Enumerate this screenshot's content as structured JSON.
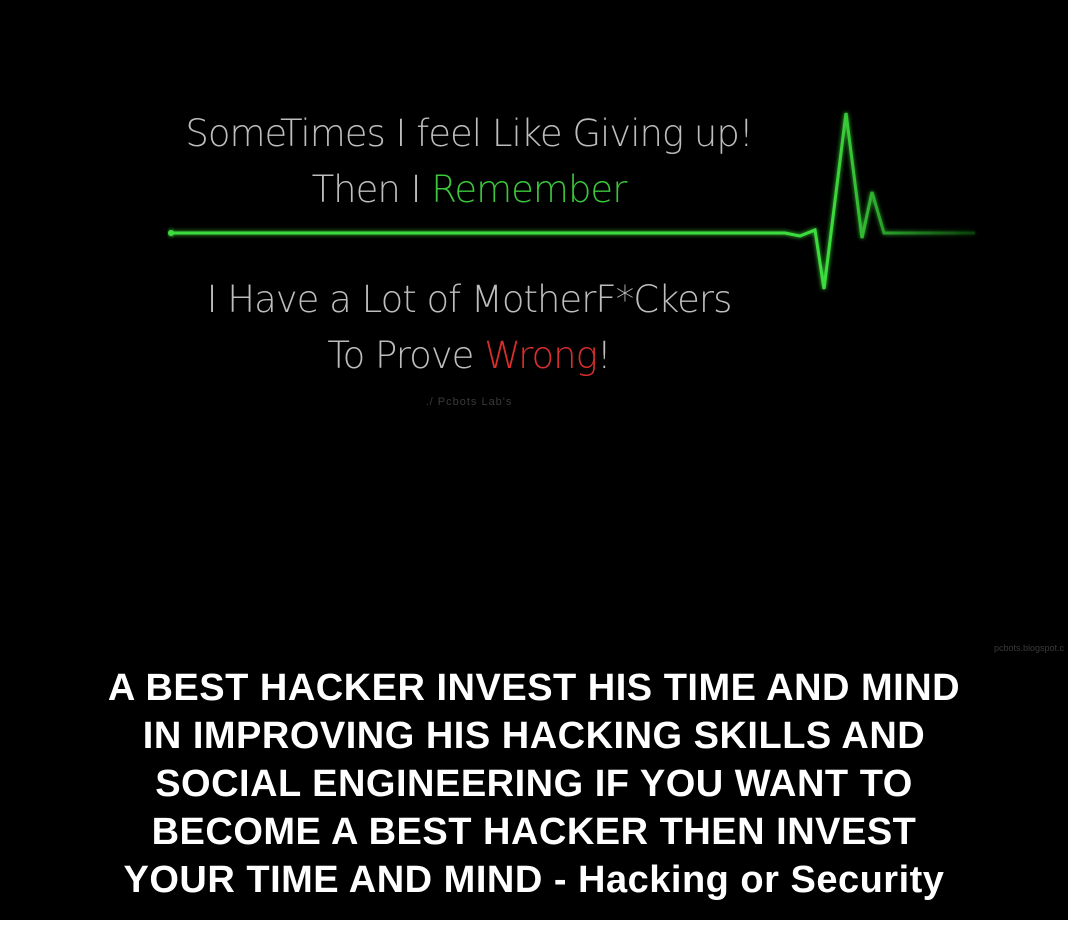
{
  "quote": {
    "line1": "SomeTimes I feel Like Giving up!",
    "line2_prefix": "Then I ",
    "line2_highlight": "Remember",
    "line3": "I Have a Lot of MotherF*Ckers",
    "line4_prefix": "To Prove ",
    "line4_highlight": "Wrong",
    "line4_suffix": "!",
    "signature": "./ Pcbots Lab's"
  },
  "watermark": "pcbots.blogspot.c",
  "caption": {
    "lines": [
      "A BEST HACKER INVEST HIS TIME AND MIND",
      "IN IMPROVING HIS HACKING SKILLS AND",
      "SOCIAL ENGINEERING IF YOU WANT TO",
      "BECOME A BEST HACKER THEN INVEST",
      "YOUR TIME AND MIND - Hacking or Security"
    ]
  },
  "colors": {
    "background": "#000000",
    "quote_text": "#bdbdbd",
    "highlight_green": "#3cc63c",
    "highlight_red": "#d92e2e",
    "ekg_line": "#3ddc3d",
    "caption_text": "#ffffff"
  }
}
